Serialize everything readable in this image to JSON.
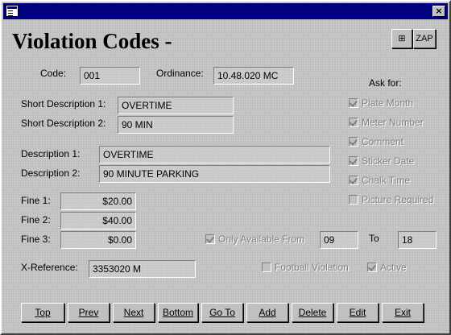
{
  "window": {
    "title": "",
    "close_label": "×"
  },
  "form": {
    "title": "Violation Codes -",
    "tool_icon_glyph": "⊞",
    "zap_label": "ZAP"
  },
  "fields": {
    "code_label": "Code:",
    "code": "001",
    "ordinance_label": "Ordinance:",
    "ordinance": "10.48.020 MC",
    "short_desc1_label": "Short Description 1:",
    "short_desc1": "OVERTIME",
    "short_desc2_label": "Short Description 2:",
    "short_desc2": "90 MIN",
    "desc1_label": "Description 1:",
    "desc1": "OVERTIME",
    "desc2_label": "Description 2:",
    "desc2": "90 MINUTE PARKING",
    "fine1_label": "Fine 1:",
    "fine1": "$20.00",
    "fine2_label": "Fine 2:",
    "fine2": "$40.00",
    "fine3_label": "Fine 3:",
    "fine3": "$0.00",
    "xref_label": "X-Reference:",
    "xref": "3353020  M",
    "only_available_from_label": "Only Available From",
    "only_available_from_checked": true,
    "from": "09",
    "to_label": "To",
    "to": "18",
    "football_label": "Football Violation",
    "football_checked": false,
    "active_label": "Active",
    "active_checked": true
  },
  "ask_for": {
    "heading": "Ask for:",
    "items": [
      {
        "label": "Plate Month",
        "checked": true
      },
      {
        "label": "Meter Number",
        "checked": true
      },
      {
        "label": "Comment",
        "checked": true
      },
      {
        "label": "Sticker Date",
        "checked": true
      },
      {
        "label": "Chalk Time",
        "checked": true
      },
      {
        "label": "Picture Required",
        "checked": false
      }
    ]
  },
  "buttons": {
    "top": "Top",
    "prev": "Prev",
    "next": "Next",
    "bottom": "Bottom",
    "goto": "Go To",
    "add": "Add",
    "delete": "Delete",
    "edit": "Edit",
    "exit": "Exit"
  }
}
